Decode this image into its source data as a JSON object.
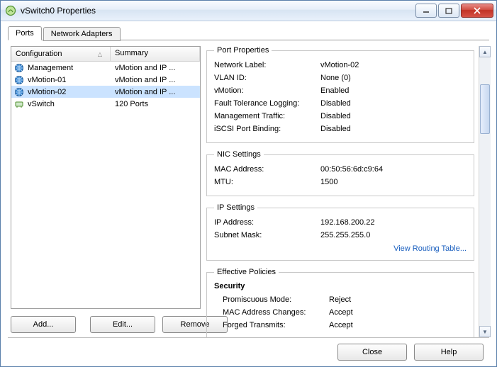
{
  "window": {
    "title": "vSwitch0 Properties"
  },
  "tabs": {
    "ports": "Ports",
    "adapters": "Network Adapters"
  },
  "list": {
    "headers": {
      "configuration": "Configuration",
      "summary": "Summary"
    },
    "rows": [
      {
        "icon": "globe-icon",
        "cfg": "Management",
        "sum": "vMotion and IP ..."
      },
      {
        "icon": "globe-icon",
        "cfg": "vMotion-01",
        "sum": "vMotion and IP ..."
      },
      {
        "icon": "globe-icon",
        "cfg": "vMotion-02",
        "sum": "vMotion and IP ..."
      },
      {
        "icon": "switch-icon",
        "cfg": "vSwitch",
        "sum": "120 Ports"
      }
    ],
    "selected_index": 2
  },
  "left_buttons": {
    "add": "Add...",
    "edit": "Edit...",
    "remove": "Remove"
  },
  "groups": {
    "port_properties": {
      "legend": "Port Properties",
      "network_label_k": "Network Label:",
      "network_label_v": "vMotion-02",
      "vlan_id_k": "VLAN ID:",
      "vlan_id_v": "None (0)",
      "vmotion_k": "vMotion:",
      "vmotion_v": "Enabled",
      "ft_k": "Fault Tolerance Logging:",
      "ft_v": "Disabled",
      "mgmt_k": "Management Traffic:",
      "mgmt_v": "Disabled",
      "iscsi_k": "iSCSI Port Binding:",
      "iscsi_v": "Disabled"
    },
    "nic_settings": {
      "legend": "NIC Settings",
      "mac_k": "MAC Address:",
      "mac_v": "00:50:56:6d:c9:64",
      "mtu_k": "MTU:",
      "mtu_v": "1500"
    },
    "ip_settings": {
      "legend": "IP Settings",
      "ip_k": "IP Address:",
      "ip_v": "192.168.200.22",
      "mask_k": "Subnet Mask:",
      "mask_v": "255.255.255.0",
      "routing_link": "View Routing Table..."
    },
    "effective_policies": {
      "legend": "Effective Policies",
      "security_heading": "Security",
      "promisc_k": "Promiscuous Mode:",
      "promisc_v": "Reject",
      "macchg_k": "MAC Address Changes:",
      "macchg_v": "Accept",
      "forged_k": "Forged Transmits:",
      "forged_v": "Accept"
    }
  },
  "bottom": {
    "close": "Close",
    "help": "Help"
  }
}
